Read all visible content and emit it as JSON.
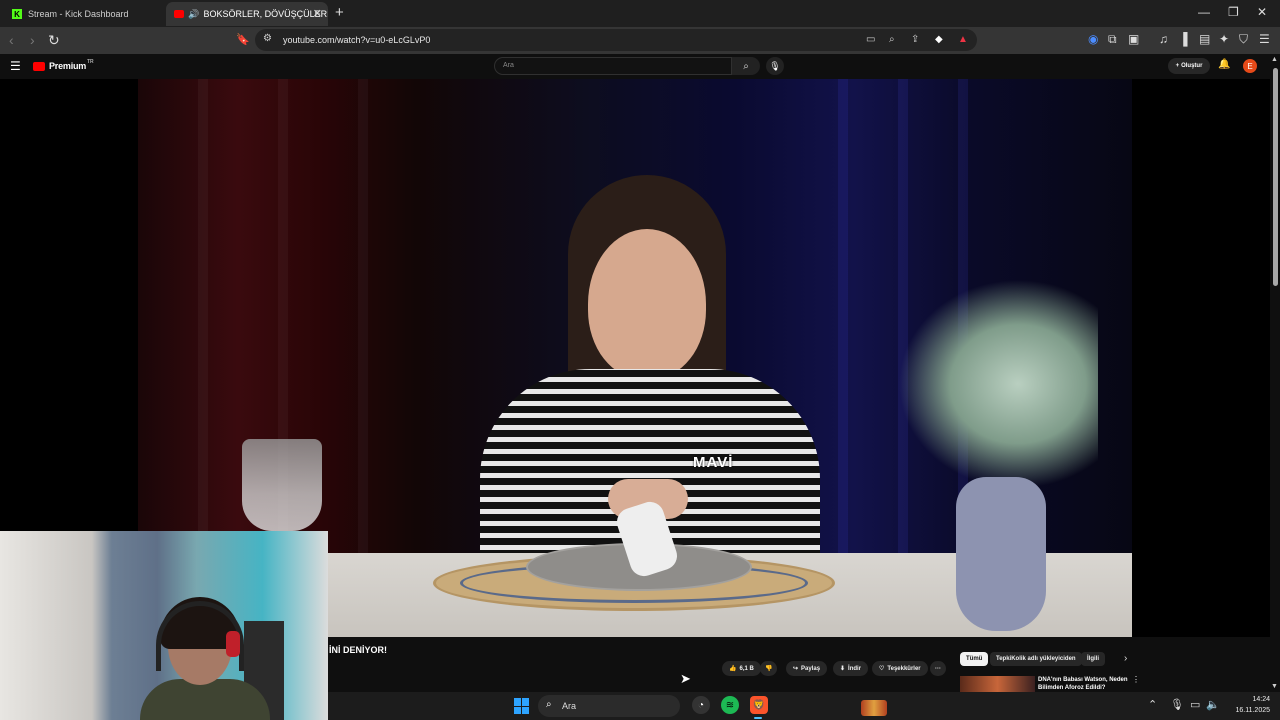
{
  "browser": {
    "tabs": [
      {
        "title": "Stream - Kick Dashboard",
        "active": false
      },
      {
        "title": "BOKSÖRLER, DÖVÜŞÇÜLERİN",
        "active": true
      }
    ],
    "url": "youtube.com/watch?v=u0-eLcGLvP0"
  },
  "youtube": {
    "logo_text": "Premium",
    "logo_sup": "TR",
    "search_placeholder": "Ara",
    "create_label": "Oluştur",
    "avatar_letter": "E",
    "video_brand": "MAVİ",
    "video_title_fragment": "İNİ DENİYOR!",
    "actions": {
      "likes": "6,1 B",
      "share": "Paylaş",
      "download": "İndir",
      "thanks": "Teşekkürler",
      "more": "···"
    },
    "chips": [
      "Tümü",
      "TepkiKolik adlı yükleyiciden",
      "İlgili"
    ],
    "recommendation_title": "DNA'nın Babası Watson, Neden Bilimden Aforoz Edildi?"
  },
  "taskbar": {
    "search_label": "Ara",
    "time": "14:24",
    "date": "16.11.2025"
  },
  "colors": {
    "accent": "#ff0000",
    "kick_green": "#53fc18",
    "windows_blue": "#2ea4ff"
  }
}
